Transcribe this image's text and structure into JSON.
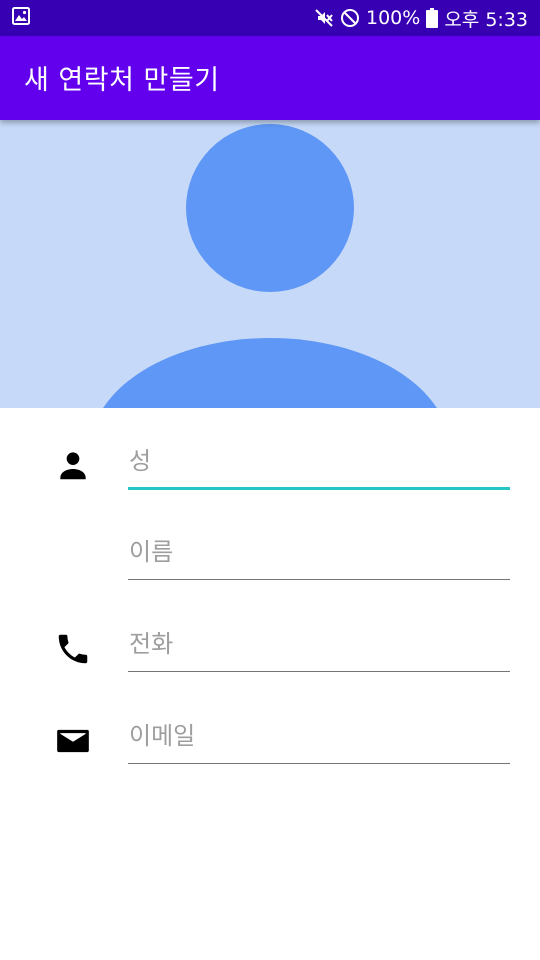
{
  "status_bar": {
    "left_icon": "image-notification-icon",
    "battery_text": "100%",
    "time_text": "오후 5:33",
    "icons": [
      "mute-icon",
      "do-not-disturb-icon",
      "battery-icon"
    ]
  },
  "app_bar": {
    "title": "새 연락처 만들기",
    "color": "#6200ee"
  },
  "avatar": {
    "icon": "person-silhouette-icon",
    "background_color": "#c6d9f8",
    "silhouette_color": "#5e97f6"
  },
  "form": {
    "last_name": {
      "placeholder": "성",
      "value": "",
      "icon": "person-icon",
      "focused": true
    },
    "first_name": {
      "placeholder": "이름",
      "value": ""
    },
    "phone": {
      "placeholder": "전화",
      "value": "",
      "icon": "phone-icon"
    },
    "email": {
      "placeholder": "이메일",
      "value": "",
      "icon": "email-icon"
    },
    "focus_color": "#26c6c6"
  }
}
